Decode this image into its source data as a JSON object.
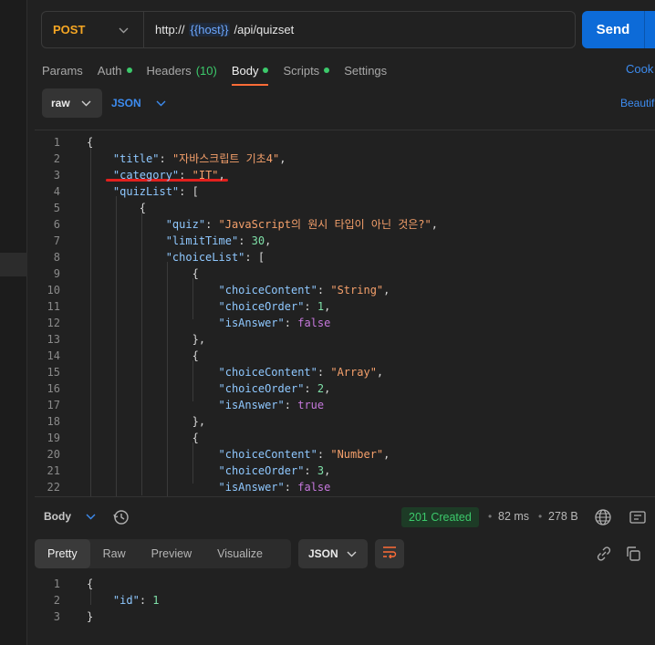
{
  "request": {
    "method": "POST",
    "url_prefix": "http://",
    "url_variable": "{{host}}",
    "url_path": "/api/quizset",
    "send_label": "Send"
  },
  "request_tabs": [
    {
      "label": "Params",
      "dot": false,
      "count": ""
    },
    {
      "label": "Auth",
      "dot": true,
      "count": ""
    },
    {
      "label": "Headers",
      "dot": false,
      "count": "(10)"
    },
    {
      "label": "Body",
      "dot": true,
      "count": "",
      "active": true
    },
    {
      "label": "Scripts",
      "dot": true,
      "count": ""
    },
    {
      "label": "Settings",
      "dot": false,
      "count": ""
    }
  ],
  "cookies_label": "Cook",
  "body_toolbar": {
    "mode": "raw",
    "format": "JSON",
    "beautify_label": "Beautif"
  },
  "request_body_lines": [
    "{",
    "    \"title\": \"자바스크립트 기초4\",",
    "    \"category\": \"IT\",",
    "    \"quizList\": [",
    "        {",
    "            \"quiz\": \"JavaScript의 원시 타입이 아닌 것은?\",",
    "            \"limitTime\": 30,",
    "            \"choiceList\": [",
    "                {",
    "                    \"choiceContent\": \"String\",",
    "                    \"choiceOrder\": 1,",
    "                    \"isAnswer\": false",
    "                },",
    "                {",
    "                    \"choiceContent\": \"Array\",",
    "                    \"choiceOrder\": 2,",
    "                    \"isAnswer\": true",
    "                },",
    "                {",
    "                    \"choiceContent\": \"Number\",",
    "                    \"choiceOrder\": 3,",
    "                    \"isAnswer\": false",
    "                },"
  ],
  "response": {
    "body_label": "Body",
    "status": "201 Created",
    "time": "82 ms",
    "size": "278 B",
    "view_tabs": [
      "Pretty",
      "Raw",
      "Preview",
      "Visualize"
    ],
    "active_view": "Pretty",
    "format": "JSON",
    "body_lines": [
      "{",
      "    \"id\": 1",
      "}"
    ]
  },
  "colors": {
    "method": "#f5a623",
    "send": "#0d6bd8",
    "accent_link": "#3d8cf0",
    "status_ok": "#3cc96b",
    "active_tab_underline": "#ff6c37",
    "annotation_underline": "#e2201d"
  },
  "icons": [
    "chevron-down-icon",
    "history-icon",
    "globe-icon",
    "save-response-icon",
    "wrap-lines-icon",
    "link-icon",
    "copy-icon"
  ]
}
